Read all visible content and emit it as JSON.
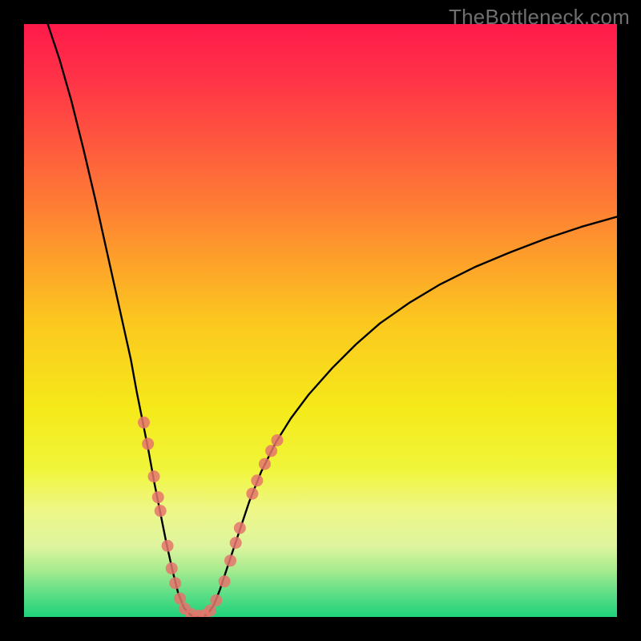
{
  "watermark": "TheBottleneck.com",
  "chart_data": {
    "type": "line",
    "title": "",
    "xlabel": "",
    "ylabel": "",
    "xlim": [
      0,
      100
    ],
    "ylim": [
      0,
      100
    ],
    "grid": false,
    "legend": false,
    "gradient_stops": [
      {
        "offset": 0.0,
        "color": "#ff1a4b"
      },
      {
        "offset": 0.1,
        "color": "#ff3547"
      },
      {
        "offset": 0.3,
        "color": "#fe7b35"
      },
      {
        "offset": 0.5,
        "color": "#fcc71f"
      },
      {
        "offset": 0.65,
        "color": "#f5ea1a"
      },
      {
        "offset": 0.75,
        "color": "#f0f53a"
      },
      {
        "offset": 0.82,
        "color": "#eef788"
      },
      {
        "offset": 0.88,
        "color": "#def59e"
      },
      {
        "offset": 0.92,
        "color": "#a9eb8f"
      },
      {
        "offset": 0.96,
        "color": "#5fdf86"
      },
      {
        "offset": 1.0,
        "color": "#1fd17b"
      }
    ],
    "series": [
      {
        "name": "curve",
        "stroke": "#000000",
        "stroke_width": 2.4,
        "points": [
          {
            "x": 4.0,
            "y": 100.0
          },
          {
            "x": 6.0,
            "y": 94.0
          },
          {
            "x": 8.0,
            "y": 87.0
          },
          {
            "x": 10.0,
            "y": 79.0
          },
          {
            "x": 12.0,
            "y": 70.5
          },
          {
            "x": 14.0,
            "y": 61.5
          },
          {
            "x": 16.0,
            "y": 52.5
          },
          {
            "x": 18.0,
            "y": 43.5
          },
          {
            "x": 19.0,
            "y": 38.0
          },
          {
            "x": 20.0,
            "y": 33.0
          },
          {
            "x": 21.0,
            "y": 28.0
          },
          {
            "x": 22.0,
            "y": 22.5
          },
          {
            "x": 23.0,
            "y": 17.5
          },
          {
            "x": 24.0,
            "y": 12.5
          },
          {
            "x": 25.0,
            "y": 8.0
          },
          {
            "x": 26.0,
            "y": 4.0
          },
          {
            "x": 27.0,
            "y": 1.5
          },
          {
            "x": 28.0,
            "y": 0.4
          },
          {
            "x": 29.0,
            "y": 0.0
          },
          {
            "x": 30.0,
            "y": 0.0
          },
          {
            "x": 31.0,
            "y": 0.5
          },
          {
            "x": 32.0,
            "y": 2.0
          },
          {
            "x": 33.0,
            "y": 4.5
          },
          {
            "x": 34.0,
            "y": 7.5
          },
          {
            "x": 35.0,
            "y": 10.5
          },
          {
            "x": 36.5,
            "y": 15.0
          },
          {
            "x": 38.0,
            "y": 19.5
          },
          {
            "x": 40.0,
            "y": 24.5
          },
          {
            "x": 42.5,
            "y": 29.5
          },
          {
            "x": 45.0,
            "y": 33.5
          },
          {
            "x": 48.0,
            "y": 37.5
          },
          {
            "x": 52.0,
            "y": 42.0
          },
          {
            "x": 56.0,
            "y": 46.0
          },
          {
            "x": 60.0,
            "y": 49.5
          },
          {
            "x": 65.0,
            "y": 53.0
          },
          {
            "x": 70.0,
            "y": 56.0
          },
          {
            "x": 76.0,
            "y": 59.0
          },
          {
            "x": 82.0,
            "y": 61.5
          },
          {
            "x": 88.0,
            "y": 63.8
          },
          {
            "x": 94.0,
            "y": 65.8
          },
          {
            "x": 100.0,
            "y": 67.5
          }
        ]
      }
    ],
    "scatter": {
      "name": "highlight-dots",
      "fill": "#e5746c",
      "opacity": 0.85,
      "radius": 7.5,
      "points": [
        {
          "x": 20.2,
          "y": 32.8
        },
        {
          "x": 20.9,
          "y": 29.2
        },
        {
          "x": 21.9,
          "y": 23.7
        },
        {
          "x": 22.6,
          "y": 20.2
        },
        {
          "x": 23.0,
          "y": 17.9
        },
        {
          "x": 24.2,
          "y": 12.0
        },
        {
          "x": 24.9,
          "y": 8.2
        },
        {
          "x": 25.5,
          "y": 5.7
        },
        {
          "x": 26.3,
          "y": 3.1
        },
        {
          "x": 27.1,
          "y": 1.4
        },
        {
          "x": 28.2,
          "y": 0.5
        },
        {
          "x": 29.4,
          "y": 0.2
        },
        {
          "x": 30.4,
          "y": 0.3
        },
        {
          "x": 31.4,
          "y": 1.1
        },
        {
          "x": 32.4,
          "y": 2.8
        },
        {
          "x": 33.8,
          "y": 6.0
        },
        {
          "x": 34.8,
          "y": 9.5
        },
        {
          "x": 35.7,
          "y": 12.5
        },
        {
          "x": 36.4,
          "y": 15.0
        },
        {
          "x": 38.5,
          "y": 20.8
        },
        {
          "x": 39.3,
          "y": 23.0
        },
        {
          "x": 40.6,
          "y": 25.8
        },
        {
          "x": 41.7,
          "y": 28.0
        },
        {
          "x": 42.7,
          "y": 29.8
        }
      ]
    }
  }
}
